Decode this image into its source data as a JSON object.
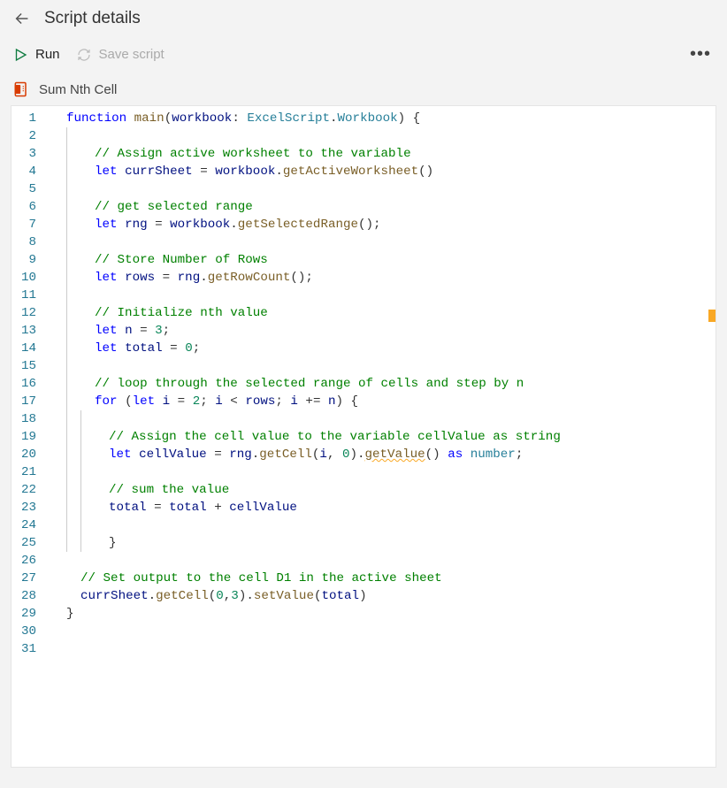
{
  "header": {
    "title": "Script details"
  },
  "toolbar": {
    "run_label": "Run",
    "save_label": "Save script",
    "more_label": "•••"
  },
  "script": {
    "name": "Sum Nth Cell"
  },
  "code": {
    "lines": [
      {
        "n": 1,
        "indent": 0,
        "guides": [],
        "segs": [
          {
            "t": "kw",
            "v": "function "
          },
          {
            "t": "func",
            "v": "main"
          },
          {
            "t": "op",
            "v": "("
          },
          {
            "t": "ident",
            "v": "workbook"
          },
          {
            "t": "op",
            "v": ": "
          },
          {
            "t": "typedark",
            "v": "ExcelScript"
          },
          {
            "t": "dot",
            "v": "."
          },
          {
            "t": "typedark",
            "v": "Workbook"
          },
          {
            "t": "op",
            "v": ") {"
          }
        ]
      },
      {
        "n": 2,
        "indent": 0,
        "guides": [
          1
        ],
        "segs": []
      },
      {
        "n": 3,
        "indent": 2,
        "guides": [
          1
        ],
        "segs": [
          {
            "t": "comment",
            "v": "// Assign active worksheet to the variable"
          }
        ]
      },
      {
        "n": 4,
        "indent": 2,
        "guides": [
          1
        ],
        "segs": [
          {
            "t": "kw",
            "v": "let "
          },
          {
            "t": "ident",
            "v": "currSheet"
          },
          {
            "t": "op",
            "v": " = "
          },
          {
            "t": "ident",
            "v": "workbook"
          },
          {
            "t": "dot",
            "v": "."
          },
          {
            "t": "func",
            "v": "getActiveWorksheet"
          },
          {
            "t": "op",
            "v": "()"
          }
        ]
      },
      {
        "n": 5,
        "indent": 0,
        "guides": [
          1
        ],
        "segs": []
      },
      {
        "n": 6,
        "indent": 2,
        "guides": [
          1
        ],
        "segs": [
          {
            "t": "comment",
            "v": "// get selected range"
          }
        ]
      },
      {
        "n": 7,
        "indent": 2,
        "guides": [
          1
        ],
        "segs": [
          {
            "t": "kw",
            "v": "let "
          },
          {
            "t": "ident",
            "v": "rng"
          },
          {
            "t": "op",
            "v": " = "
          },
          {
            "t": "ident",
            "v": "workbook"
          },
          {
            "t": "dot",
            "v": "."
          },
          {
            "t": "func",
            "v": "getSelectedRange"
          },
          {
            "t": "op",
            "v": "();"
          }
        ]
      },
      {
        "n": 8,
        "indent": 0,
        "guides": [
          1
        ],
        "segs": []
      },
      {
        "n": 9,
        "indent": 2,
        "guides": [
          1
        ],
        "segs": [
          {
            "t": "comment",
            "v": "// Store Number of Rows"
          }
        ]
      },
      {
        "n": 10,
        "indent": 2,
        "guides": [
          1
        ],
        "segs": [
          {
            "t": "kw",
            "v": "let "
          },
          {
            "t": "ident",
            "v": "rows"
          },
          {
            "t": "op",
            "v": " = "
          },
          {
            "t": "ident",
            "v": "rng"
          },
          {
            "t": "dot",
            "v": "."
          },
          {
            "t": "func",
            "v": "getRowCount"
          },
          {
            "t": "op",
            "v": "();"
          }
        ]
      },
      {
        "n": 11,
        "indent": 0,
        "guides": [
          1
        ],
        "segs": []
      },
      {
        "n": 12,
        "indent": 2,
        "guides": [
          1
        ],
        "segs": [
          {
            "t": "comment",
            "v": "// Initialize nth value"
          }
        ]
      },
      {
        "n": 13,
        "indent": 2,
        "guides": [
          1
        ],
        "segs": [
          {
            "t": "kw",
            "v": "let "
          },
          {
            "t": "ident",
            "v": "n"
          },
          {
            "t": "op",
            "v": " = "
          },
          {
            "t": "num",
            "v": "3"
          },
          {
            "t": "op",
            "v": ";"
          }
        ]
      },
      {
        "n": 14,
        "indent": 2,
        "guides": [
          1
        ],
        "segs": [
          {
            "t": "kw",
            "v": "let "
          },
          {
            "t": "ident",
            "v": "total"
          },
          {
            "t": "op",
            "v": " = "
          },
          {
            "t": "num",
            "v": "0"
          },
          {
            "t": "op",
            "v": ";"
          }
        ]
      },
      {
        "n": 15,
        "indent": 0,
        "guides": [
          1
        ],
        "segs": []
      },
      {
        "n": 16,
        "indent": 2,
        "guides": [
          1
        ],
        "segs": [
          {
            "t": "comment",
            "v": "// loop through the selected range of cells and step by n"
          }
        ]
      },
      {
        "n": 17,
        "indent": 2,
        "guides": [
          1
        ],
        "segs": [
          {
            "t": "kw",
            "v": "for "
          },
          {
            "t": "op",
            "v": "("
          },
          {
            "t": "kw",
            "v": "let "
          },
          {
            "t": "ident",
            "v": "i"
          },
          {
            "t": "op",
            "v": " = "
          },
          {
            "t": "num",
            "v": "2"
          },
          {
            "t": "op",
            "v": "; "
          },
          {
            "t": "ident",
            "v": "i"
          },
          {
            "t": "op",
            "v": " < "
          },
          {
            "t": "ident",
            "v": "rows"
          },
          {
            "t": "op",
            "v": "; "
          },
          {
            "t": "ident",
            "v": "i"
          },
          {
            "t": "op",
            "v": " += "
          },
          {
            "t": "ident",
            "v": "n"
          },
          {
            "t": "op",
            "v": ") {"
          }
        ]
      },
      {
        "n": 18,
        "indent": 0,
        "guides": [
          1,
          2
        ],
        "segs": []
      },
      {
        "n": 19,
        "indent": 3,
        "guides": [
          1,
          2
        ],
        "segs": [
          {
            "t": "comment",
            "v": "// Assign the cell value to the variable cellValue as string"
          }
        ]
      },
      {
        "n": 20,
        "indent": 3,
        "guides": [
          1,
          2
        ],
        "segs": [
          {
            "t": "kw",
            "v": "let "
          },
          {
            "t": "ident",
            "v": "cellValue"
          },
          {
            "t": "op",
            "v": " = "
          },
          {
            "t": "ident",
            "v": "rng"
          },
          {
            "t": "dot",
            "v": "."
          },
          {
            "t": "func",
            "v": "getCell"
          },
          {
            "t": "op",
            "v": "("
          },
          {
            "t": "ident",
            "v": "i"
          },
          {
            "t": "op",
            "v": ", "
          },
          {
            "t": "num",
            "v": "0"
          },
          {
            "t": "op",
            "v": ")."
          },
          {
            "t": "func",
            "v": "getValue",
            "wavy": true
          },
          {
            "t": "op",
            "v": "() "
          },
          {
            "t": "kw",
            "v": "as "
          },
          {
            "t": "type",
            "v": "number"
          },
          {
            "t": "op",
            "v": ";"
          }
        ]
      },
      {
        "n": 21,
        "indent": 0,
        "guides": [
          1,
          2
        ],
        "segs": []
      },
      {
        "n": 22,
        "indent": 3,
        "guides": [
          1,
          2
        ],
        "segs": [
          {
            "t": "comment",
            "v": "// sum the value"
          }
        ]
      },
      {
        "n": 23,
        "indent": 3,
        "guides": [
          1,
          2
        ],
        "segs": [
          {
            "t": "ident",
            "v": "total"
          },
          {
            "t": "op",
            "v": " = "
          },
          {
            "t": "ident",
            "v": "total"
          },
          {
            "t": "op",
            "v": " + "
          },
          {
            "t": "ident",
            "v": "cellValue"
          }
        ]
      },
      {
        "n": 24,
        "indent": 0,
        "guides": [
          1,
          2
        ],
        "segs": []
      },
      {
        "n": 25,
        "indent": 3,
        "guides": [
          1,
          2
        ],
        "segs": [
          {
            "t": "op",
            "v": "}"
          }
        ]
      },
      {
        "n": 26,
        "indent": 0,
        "guides": [],
        "segs": []
      },
      {
        "n": 27,
        "indent": 1,
        "guides": [],
        "segs": [
          {
            "t": "comment",
            "v": "// Set output to the cell D1 in the active sheet"
          }
        ]
      },
      {
        "n": 28,
        "indent": 1,
        "guides": [],
        "segs": [
          {
            "t": "ident",
            "v": "currSheet"
          },
          {
            "t": "dot",
            "v": "."
          },
          {
            "t": "func",
            "v": "getCell"
          },
          {
            "t": "op",
            "v": "("
          },
          {
            "t": "num",
            "v": "0"
          },
          {
            "t": "op",
            "v": ","
          },
          {
            "t": "num",
            "v": "3"
          },
          {
            "t": "op",
            "v": ")."
          },
          {
            "t": "func",
            "v": "setValue"
          },
          {
            "t": "op",
            "v": "("
          },
          {
            "t": "ident",
            "v": "total"
          },
          {
            "t": "op",
            "v": ")"
          }
        ]
      },
      {
        "n": 29,
        "indent": 0,
        "guides": [],
        "segs": [
          {
            "t": "op",
            "v": "}"
          }
        ]
      },
      {
        "n": 30,
        "indent": 0,
        "guides": [],
        "segs": []
      },
      {
        "n": 31,
        "indent": 0,
        "guides": [],
        "segs": []
      }
    ]
  }
}
